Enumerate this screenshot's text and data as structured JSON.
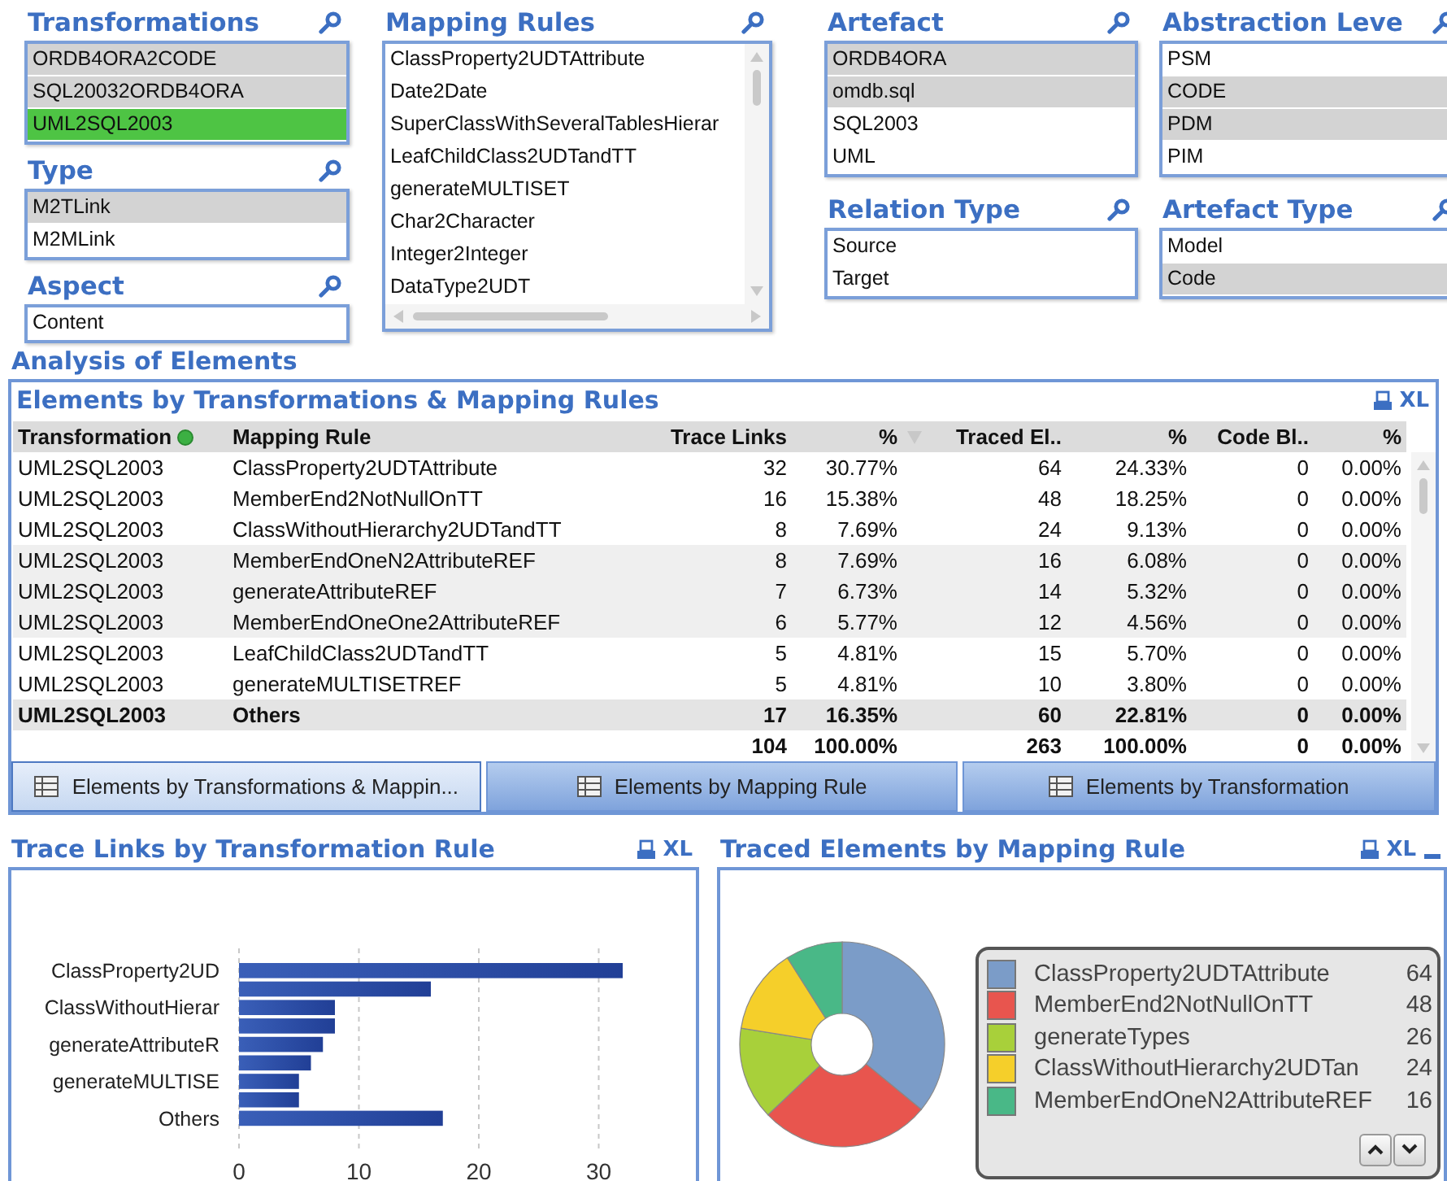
{
  "filter_columns": [
    {
      "filters": [
        {
          "title": "Transformations",
          "items": [
            {
              "label": "ORDB4ORA2CODE",
              "selected": false,
              "excluded": true
            },
            {
              "label": "SQL20032ORDB4ORA",
              "selected": false,
              "excluded": true
            },
            {
              "label": "UML2SQL2003",
              "selected": true,
              "excluded": false
            }
          ]
        },
        {
          "title": "Type",
          "items": [
            {
              "label": "M2TLink",
              "selected": false,
              "excluded": true
            },
            {
              "label": "M2MLink",
              "selected": false,
              "excluded": false
            }
          ]
        },
        {
          "title": "Aspect",
          "items": [
            {
              "label": "Content",
              "selected": false,
              "excluded": false
            }
          ]
        }
      ]
    },
    {
      "filters": [
        {
          "title": "Mapping Rules",
          "scrollbars": true,
          "items": [
            {
              "label": "ClassProperty2UDTAttribute",
              "selected": false,
              "excluded": false
            },
            {
              "label": "Date2Date",
              "selected": false,
              "excluded": false
            },
            {
              "label": "SuperClassWithSeveralTablesHierar",
              "selected": false,
              "excluded": false
            },
            {
              "label": "LeafChildClass2UDTandTT",
              "selected": false,
              "excluded": false
            },
            {
              "label": "generateMULTISET",
              "selected": false,
              "excluded": false
            },
            {
              "label": "Char2Character",
              "selected": false,
              "excluded": false
            },
            {
              "label": "Integer2Integer",
              "selected": false,
              "excluded": false
            },
            {
              "label": "DataType2UDT",
              "selected": false,
              "excluded": false
            }
          ]
        }
      ]
    },
    {
      "filters": [
        {
          "title": "Artefact",
          "items": [
            {
              "label": "ORDB4ORA",
              "selected": false,
              "excluded": true
            },
            {
              "label": "omdb.sql",
              "selected": false,
              "excluded": true
            },
            {
              "label": "SQL2003",
              "selected": false,
              "excluded": false
            },
            {
              "label": "UML",
              "selected": false,
              "excluded": false
            }
          ]
        },
        {
          "title": "Relation Type",
          "items": [
            {
              "label": "Source",
              "selected": false,
              "excluded": false
            },
            {
              "label": "Target",
              "selected": false,
              "excluded": false
            }
          ]
        }
      ]
    },
    {
      "filters": [
        {
          "title": "Abstraction Leve",
          "items": [
            {
              "label": "PSM",
              "selected": false,
              "excluded": false
            },
            {
              "label": "CODE",
              "selected": false,
              "excluded": true
            },
            {
              "label": "PDM",
              "selected": false,
              "excluded": true
            },
            {
              "label": "PIM",
              "selected": false,
              "excluded": false
            }
          ]
        },
        {
          "title": "Artefact Type",
          "items": [
            {
              "label": "Model",
              "selected": false,
              "excluded": false
            },
            {
              "label": "Code",
              "selected": false,
              "excluded": true
            }
          ]
        }
      ]
    }
  ],
  "analysis_title": "Analysis of Elements",
  "table_panel": {
    "title": "Elements by Transformations & Mapping Rules",
    "export_label": "XL",
    "columns": [
      {
        "label": "Transformation",
        "filtered": true,
        "sorted": false
      },
      {
        "label": "Mapping Rule",
        "filtered": false,
        "sorted": false
      },
      {
        "label": "Trace Links",
        "filtered": false,
        "sorted": false
      },
      {
        "label": "%",
        "filtered": false,
        "sorted": false
      },
      {
        "label": "Traced El..",
        "filtered": false,
        "sorted": true
      },
      {
        "label": "%",
        "filtered": false,
        "sorted": false
      },
      {
        "label": "Code Bl..",
        "filtered": false,
        "sorted": false
      },
      {
        "label": "%",
        "filtered": false,
        "sorted": false
      }
    ],
    "rows": [
      {
        "kind": "data",
        "cells": [
          "UML2SQL2003",
          "ClassProperty2UDTAttribute",
          "32",
          "30.77%",
          "64",
          "24.33%",
          "0",
          "0.00%"
        ]
      },
      {
        "kind": "data",
        "cells": [
          "UML2SQL2003",
          "MemberEnd2NotNullOnTT",
          "16",
          "15.38%",
          "48",
          "18.25%",
          "0",
          "0.00%"
        ]
      },
      {
        "kind": "data",
        "cells": [
          "UML2SQL2003",
          "ClassWithoutHierarchy2UDTandTT",
          "8",
          "7.69%",
          "24",
          "9.13%",
          "0",
          "0.00%"
        ]
      },
      {
        "kind": "data",
        "cells": [
          "UML2SQL2003",
          "MemberEndOneN2AttributeREF",
          "8",
          "7.69%",
          "16",
          "6.08%",
          "0",
          "0.00%"
        ]
      },
      {
        "kind": "data",
        "cells": [
          "UML2SQL2003",
          "generateAttributeREF",
          "7",
          "6.73%",
          "14",
          "5.32%",
          "0",
          "0.00%"
        ]
      },
      {
        "kind": "data",
        "cells": [
          "UML2SQL2003",
          "MemberEndOneOne2AttributeREF",
          "6",
          "5.77%",
          "12",
          "4.56%",
          "0",
          "0.00%"
        ]
      },
      {
        "kind": "data",
        "cells": [
          "UML2SQL2003",
          "LeafChildClass2UDTandTT",
          "5",
          "4.81%",
          "15",
          "5.70%",
          "0",
          "0.00%"
        ]
      },
      {
        "kind": "data",
        "cells": [
          "UML2SQL2003",
          "generateMULTISETREF",
          "5",
          "4.81%",
          "10",
          "3.80%",
          "0",
          "0.00%"
        ]
      },
      {
        "kind": "subtotal",
        "cells": [
          "UML2SQL2003",
          "Others",
          "17",
          "16.35%",
          "60",
          "22.81%",
          "0",
          "0.00%"
        ]
      },
      {
        "kind": "total",
        "cells": [
          null,
          null,
          "104",
          "100.00%",
          "263",
          "100.00%",
          "0",
          "0.00%"
        ]
      }
    ],
    "tabs": [
      {
        "label": "Elements by Transformations & Mappin...",
        "selected": true
      },
      {
        "label": "Elements by Mapping Rule",
        "selected": false
      },
      {
        "label": "Elements by Transformation",
        "selected": false
      }
    ]
  },
  "charts": [
    {
      "title": "Trace Links by Transformation Rule",
      "export_label": "XL",
      "minimizable": false,
      "chart_data": {
        "type": "bar",
        "orientation": "horizontal",
        "categories": [
          "ClassProperty2UD",
          null,
          "ClassWithoutHierar",
          null,
          "generateAttributeR",
          null,
          "generateMULTISE",
          null,
          "Others"
        ],
        "values": [
          32,
          16,
          8,
          8,
          7,
          6,
          5,
          5,
          17
        ],
        "xlim": [
          0,
          32
        ],
        "xticks": [
          0,
          10,
          20,
          30
        ],
        "grid": true
      }
    },
    {
      "title": "Traced Elements by Mapping Rule",
      "export_label": "XL",
      "minimizable": true,
      "chart_data": {
        "type": "donut",
        "categories": [
          "ClassProperty2UDTAttribute",
          "MemberEnd2NotNullOnTT",
          "generateTypes",
          "ClassWithoutHierarchy2UDTan",
          "MemberEndOneN2AttributeREF"
        ],
        "values": [
          64,
          48,
          26,
          24,
          16
        ],
        "colors": [
          "#7b9cc8",
          "#e8554e",
          "#a8d03a",
          "#f5cf2a",
          "#49b887"
        ],
        "value_labels": [
          "64",
          "48",
          "26",
          "24",
          "16"
        ],
        "legend": true
      }
    }
  ]
}
